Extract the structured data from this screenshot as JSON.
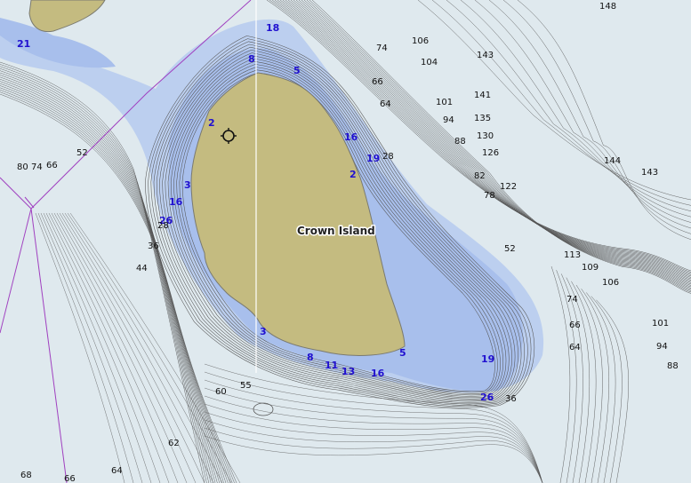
{
  "map": {
    "island_label": "Crown Island",
    "colors": {
      "deep_water": "#dfe9ee",
      "shallow_water": "#a8bfec",
      "shelf_water": "#bccfef",
      "land": "#c4bb80",
      "contour": "#555555",
      "boundary": "#a040c0",
      "shallow_sounding": "#2010d0"
    },
    "icons": [
      "waypoint-icon"
    ],
    "soundings_shallow": [
      "18",
      "8",
      "5",
      "2",
      "16",
      "19",
      "2",
      "3",
      "16",
      "26",
      "3",
      "8",
      "11",
      "13",
      "16",
      "5",
      "19",
      "26",
      "21"
    ],
    "soundings_deep": [
      "148",
      "74",
      "106",
      "104",
      "143",
      "66",
      "64",
      "101",
      "141",
      "94",
      "135",
      "88",
      "130",
      "126",
      "144",
      "143",
      "28",
      "82",
      "122",
      "78",
      "52",
      "113",
      "109",
      "106",
      "74",
      "66",
      "64",
      "101",
      "94",
      "88",
      "80",
      "74",
      "66",
      "52",
      "28",
      "36",
      "44",
      "60",
      "55",
      "36",
      "62",
      "68",
      "66",
      "64"
    ]
  }
}
